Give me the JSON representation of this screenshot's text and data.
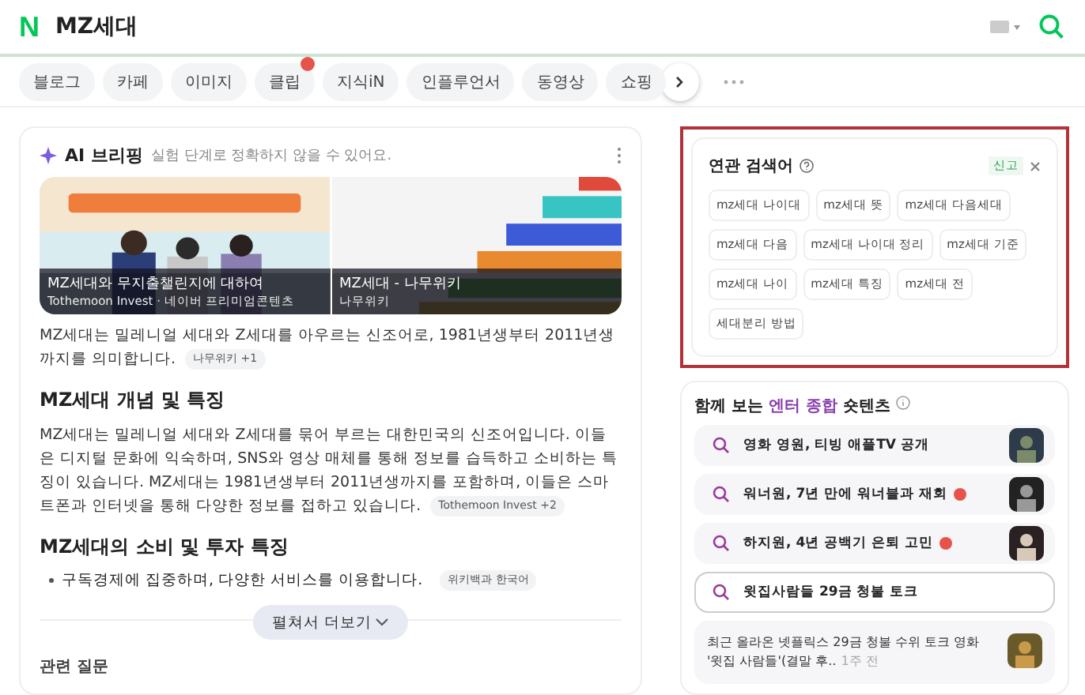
{
  "header": {
    "logo": "N",
    "query": "MZ세대"
  },
  "nav_tabs": [
    {
      "label": "블로그",
      "badge": false
    },
    {
      "label": "카페",
      "badge": false
    },
    {
      "label": "이미지",
      "badge": false
    },
    {
      "label": "클립",
      "badge": true
    },
    {
      "label": "지식iN",
      "badge": false
    },
    {
      "label": "인플루언서",
      "badge": false
    },
    {
      "label": "동영상",
      "badge": false
    },
    {
      "label": "쇼핑",
      "badge": false
    }
  ],
  "ai_briefing": {
    "title": "AI 브리핑",
    "note": "실험 단계로 정확하지 않을 수 있어요.",
    "images": [
      {
        "caption": "MZ세대와 무지출챌린지에 대하여",
        "source": "Tothemoon Invest · 네이버 프리미엄콘텐츠",
        "kind": "people"
      },
      {
        "caption": "MZ세대 - 나무위키",
        "source": "나무위키",
        "kind": "bars"
      }
    ],
    "intro": "MZ세대는 밀레니얼 세대와 Z세대를 아우르는 신조어로, 1981년생부터 2011년생까지를 의미합니다.",
    "intro_cite": "나무위키 +1",
    "sections": [
      {
        "heading": "MZ세대 개념 및 특징",
        "kind": "paragraph",
        "text": "MZ세대는 밀레니얼 세대와 Z세대를 묶어 부르는 대한민국의 신조어입니다. 이들은 디지털 문화에 익숙하며, SNS와 영상 매체를 통해 정보를 습득하고 소비하는 특징이 있습니다. MZ세대는 1981년생부터 2011년생까지를 포함하며, 이들은 스마트폰과 인터넷을 통해 다양한 정보를 접하고 있습니다.",
        "cite": "Tothemoon Invest +2"
      },
      {
        "heading": "MZ세대의 소비 및 투자 특징",
        "kind": "bullet",
        "text": "구독경제에 집중하며, 다양한 서비스를 이용합니다.",
        "cite": "위키백과 한국어"
      }
    ],
    "more_button": "펼쳐서 더보기",
    "next_heading": "관련 질문"
  },
  "related": {
    "title": "연관 검색어",
    "report": "신고",
    "chips": [
      "mz세대 나이대",
      "mz세대 뜻",
      "mz세대 다음세대",
      "mz세대 다음",
      "mz세대 나이대 정리",
      "mz세대 기준",
      "mz세대 나이",
      "mz세대 특징",
      "mz세대 전",
      "세대분리 방법"
    ]
  },
  "shortents": {
    "title_before": "함께 보는",
    "title_topic": "엔터 종합",
    "title_after": "숏텐츠",
    "items": [
      {
        "kind": "row",
        "text": "영화 영원, 티빙 애플TV 공개",
        "new": false,
        "selected": false
      },
      {
        "kind": "row",
        "text": "워너원, 7년 만에 워너블과 재회",
        "new": true,
        "selected": false
      },
      {
        "kind": "row",
        "text": "하지원, 4년 공백기 은퇴 고민",
        "new": true,
        "selected": false
      },
      {
        "kind": "expanded",
        "text": "윗집사람들 29금 청불 토크",
        "new": false,
        "selected": true,
        "summary": "최근 올라온 넷플릭스 29금 청불 수위 토크 영화 '윗집 사람들'(결말 후..",
        "time": "1주 전"
      }
    ]
  }
}
